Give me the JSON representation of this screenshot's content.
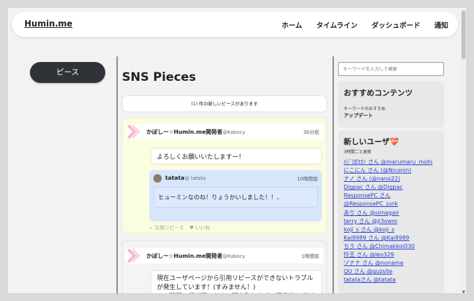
{
  "navbar": {
    "brand": "Humin.me",
    "links": [
      "ホーム",
      "タイムライン",
      "ダッシュボード",
      "通知"
    ]
  },
  "sidebar_left": {
    "pieces_button": "ピース"
  },
  "main": {
    "title": "SNS Pieces",
    "new_notice": "(1) 件の新しいピースがあります",
    "posts": [
      {
        "author": "かぼしー☆Humin.me開発者",
        "handle": "@Kabocy",
        "time": "30分前",
        "body": "よろしくお願いいたしますー！",
        "quote": {
          "author": "tatata",
          "handle": "@ tatata",
          "time": "10時間前",
          "body": "ヒューミンなのね！りょうかいしました！！、"
        },
        "actions": {
          "requote": "引用リピース",
          "like": "いいね"
        }
      },
      {
        "author": "かぼしー☆Humin.me開発者",
        "handle": "@Kabocy",
        "time": "1時間前",
        "body": "現在ユーザページから引用リピースができないトラブルが発生しています！(すみません！)\nこの問題は根が深いため、現在取り急ぎの回避策を検討"
      }
    ]
  },
  "sidebar_right": {
    "search_placeholder": "キーワードを入力して検索",
    "recommended": {
      "title": "おすすめコンテンツ",
      "subtitle": "キーワードのおすすめ",
      "item": "アップデート"
    },
    "new_users": {
      "title": "新しいユーザ💝",
      "subtitle": "3時間ごと更新",
      "users": [
        "ﾒｼﾞﾛEtｶﾝ さん @marumaru_mohi",
        "にこにん さん (@Niconin)",
        "ナノ さん (@nano22)",
        "Digpac さん @Digpac",
        "ResponsePC さん",
        "@ResponsePC_junk",
        "あり さん @simagair",
        "terry さん @ji3owm",
        "koji_s さん @koji_s",
        "Kai8989 さん @Kai8989",
        "ちう さん @Chimakkoi030",
        "怜王 さん @leo329",
        "ゾナナ さん @noname",
        "QU さん @quzsite",
        "tatataさん @tatata"
      ]
    }
  },
  "colors": {
    "pieces_button": "#2f3338",
    "post_highlight": "#fbfde0",
    "quote_bg": "#d7e7fb",
    "link": "#2a3fd0"
  }
}
